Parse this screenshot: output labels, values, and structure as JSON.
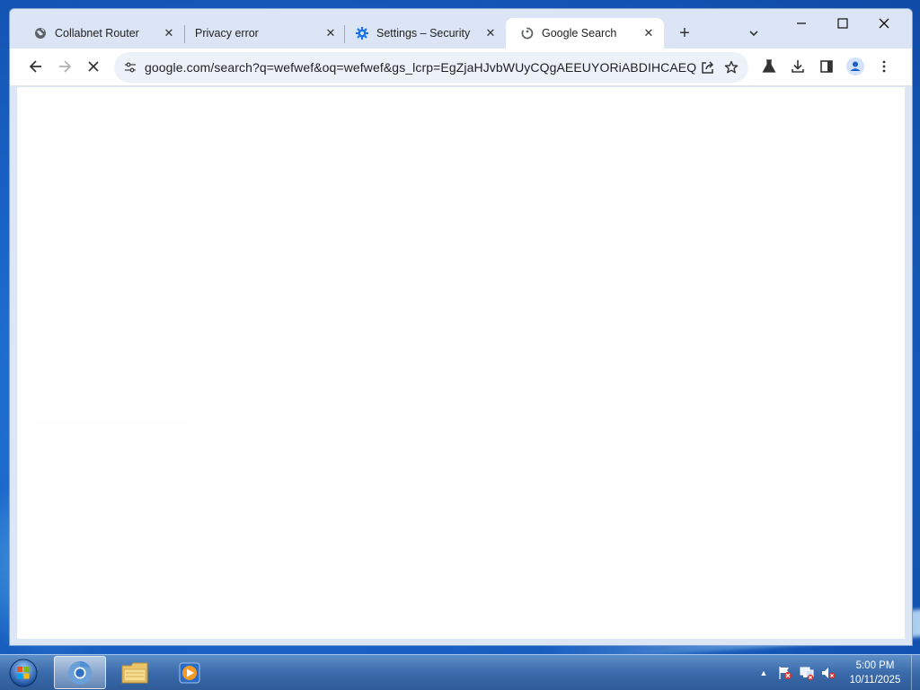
{
  "window": {
    "tabs": [
      {
        "title": "Collabnet Router",
        "icon": "globe-icon"
      },
      {
        "title": "Privacy error",
        "icon": "none"
      },
      {
        "title": "Settings – Security",
        "icon": "gear-icon"
      },
      {
        "title": "Google Search",
        "icon": "loading-icon",
        "active": true
      }
    ],
    "new_tab_symbol": "+",
    "close_symbol": "✕"
  },
  "toolbar": {
    "url": "google.com/search?q=wefwef&oq=wefwef&gs_lcrp=EgZjaHJvbWUyCQgAEEUYORiABDIHCAEQABi..."
  },
  "page": {
    "ghost_text": "....................................................."
  },
  "taskbar": {
    "time": "5:00 PM",
    "date": "10/11/2025",
    "tray_arrow": "▲"
  },
  "colors": {
    "accent": "#1a73e8",
    "tab_strip": "#dbe5f5",
    "omnibox": "#edf2fa"
  }
}
